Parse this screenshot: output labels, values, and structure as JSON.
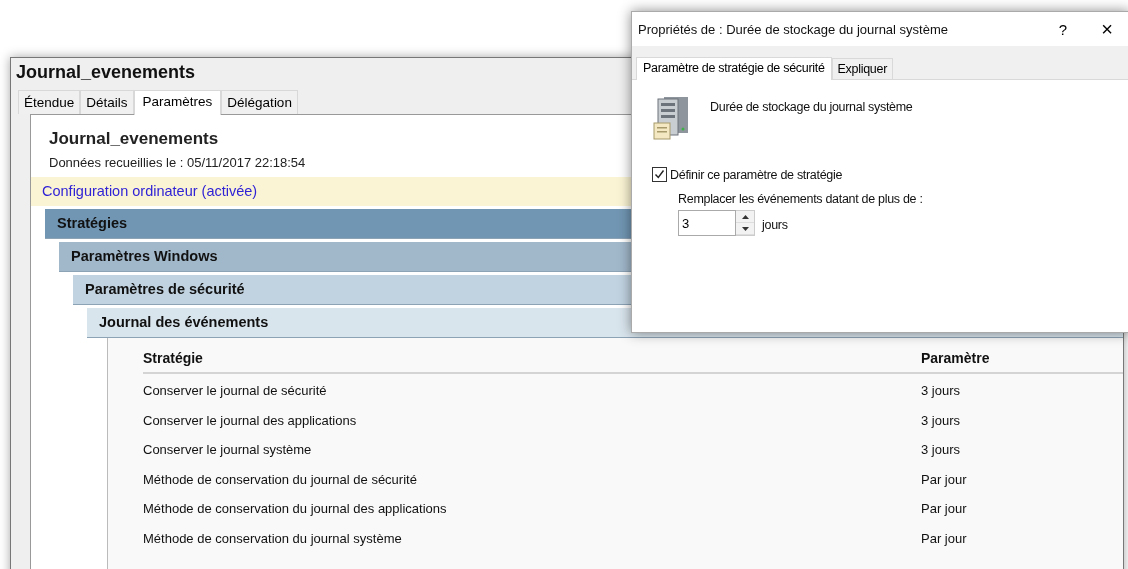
{
  "main_window": {
    "title": "Journal_evenements",
    "tabs": [
      {
        "label": "Étendue",
        "selected": false
      },
      {
        "label": "Détails",
        "selected": false
      },
      {
        "label": "Paramètres",
        "selected": true
      },
      {
        "label": "Délégation",
        "selected": false
      }
    ],
    "report": {
      "title": "Journal_evenements",
      "collected": "Données recueillies le : 05/11/2017 22:18:54",
      "section": "Configuration ordinateur (activée)",
      "tree": [
        {
          "title": "Stratégies",
          "children": [
            {
              "title": "Paramètres Windows",
              "children": [
                {
                  "title": "Paramètres de sécurité",
                  "children": [
                    {
                      "title": "Journal des événements"
                    }
                  ]
                }
              ]
            }
          ]
        }
      ],
      "table": {
        "columns": [
          "Stratégie",
          "Paramètre"
        ],
        "rows": [
          [
            "Conserver le journal de sécurité",
            "3 jours"
          ],
          [
            "Conserver le journal des applications",
            "3 jours"
          ],
          [
            "Conserver le journal système",
            "3 jours"
          ],
          [
            "Méthode de conservation du journal de sécurité",
            "Par jour"
          ],
          [
            "Méthode de conservation du journal des applications",
            "Par jour"
          ],
          [
            "Méthode de conservation du journal système",
            "Par jour"
          ]
        ]
      }
    }
  },
  "dialog": {
    "title": "Propriétés de : Durée de stockage du journal système",
    "help": "?",
    "close": "×",
    "tabs": [
      {
        "label": "Paramètre de stratégie de sécurité",
        "selected": true
      },
      {
        "label": "Expliquer",
        "selected": false
      }
    ],
    "policy_name": "Durée de stockage du journal système",
    "define": {
      "label": "Définir ce paramètre de stratégie",
      "checked": true
    },
    "replace_label": "Remplacer les événements datant de plus de :",
    "days": {
      "value": "3",
      "unit": "jours"
    }
  }
}
